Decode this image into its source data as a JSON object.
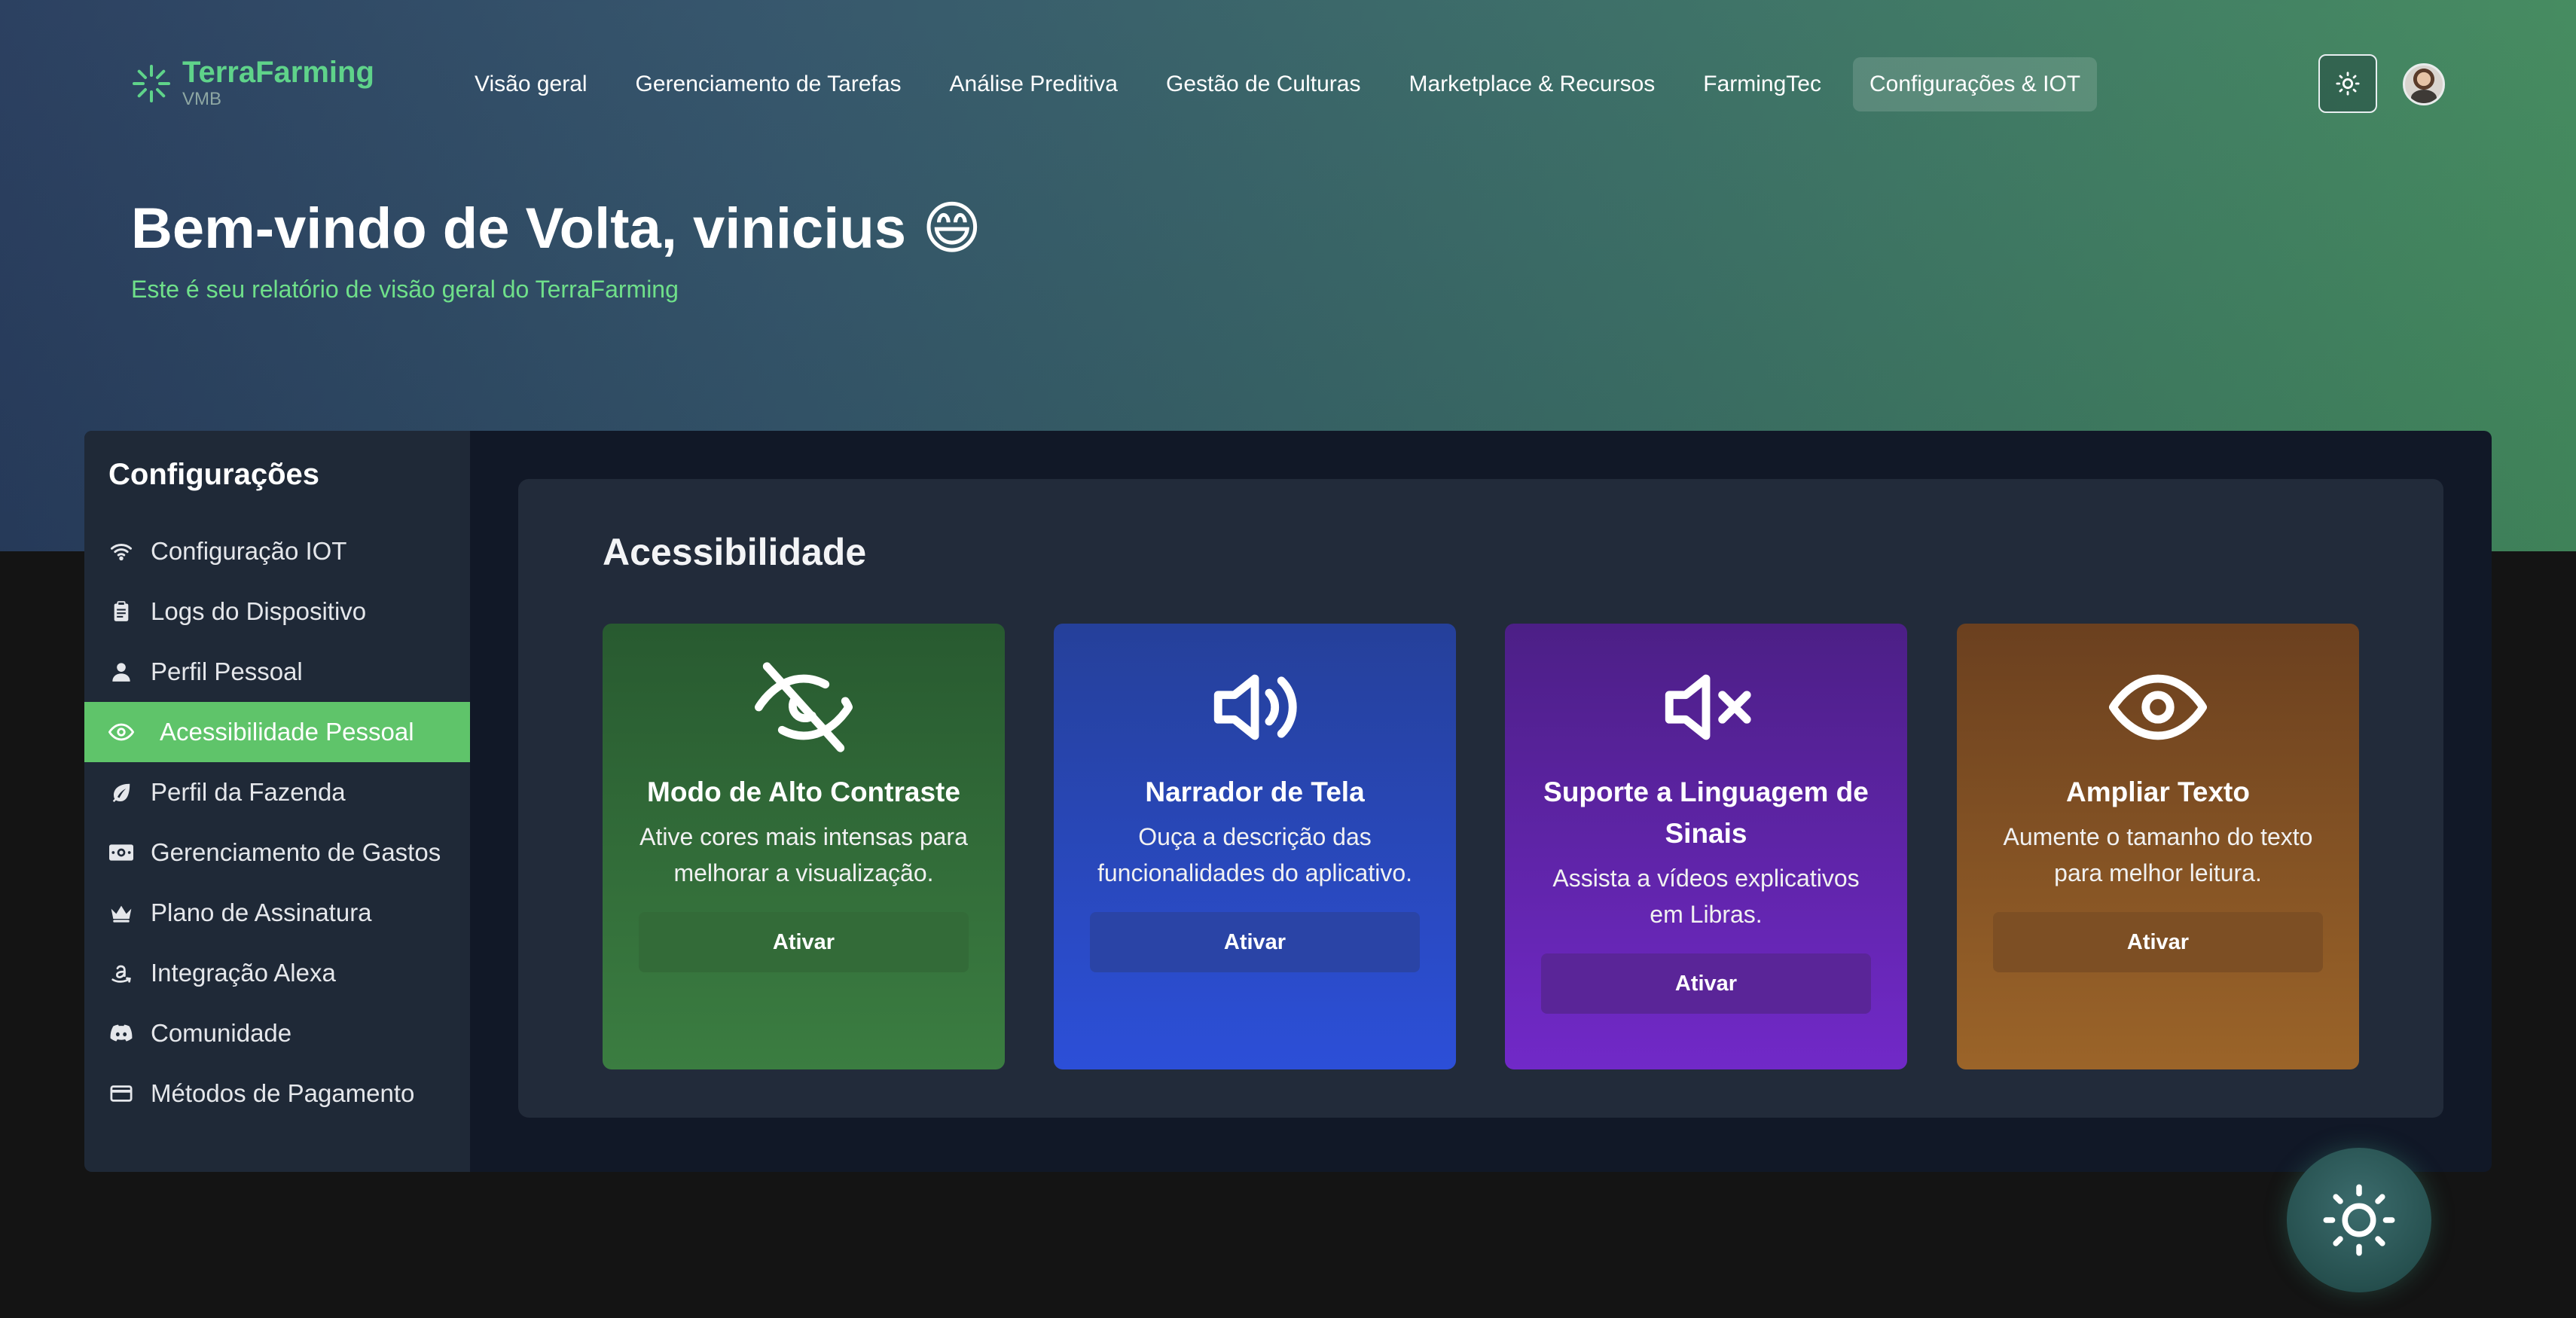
{
  "app": {
    "name": "TerraFarming",
    "sub": "VMB"
  },
  "nav": {
    "items": [
      {
        "label": "Visão geral"
      },
      {
        "label": "Gerenciamento de Tarefas"
      },
      {
        "label": "Análise Preditiva"
      },
      {
        "label": "Gestão de Culturas"
      },
      {
        "label": "Marketplace & Recursos"
      },
      {
        "label": "FarmingTec"
      },
      {
        "label": "Configurações & IOT",
        "active": true
      }
    ]
  },
  "header": {
    "theme_toggle_icon": "sun-icon",
    "avatar": "user-avatar"
  },
  "hero": {
    "welcome": "Bem-vindo de Volta, vinicius 😄",
    "subtitle": "Este é seu relatório de visão geral do TerraFarming"
  },
  "sidebar": {
    "title": "Configurações",
    "items": [
      {
        "label": "Configuração IOT",
        "icon": "wifi-icon"
      },
      {
        "label": "Logs do Dispositivo",
        "icon": "clipboard-icon"
      },
      {
        "label": "Perfil Pessoal",
        "icon": "user-icon"
      },
      {
        "label": "Acessibilidade Pessoal",
        "icon": "eye-icon",
        "active": true
      },
      {
        "label": "Perfil da Fazenda",
        "icon": "leaf-icon"
      },
      {
        "label": "Gerenciamento de Gastos",
        "icon": "money-icon"
      },
      {
        "label": "Plano de Assinatura",
        "icon": "crown-icon"
      },
      {
        "label": "Integração Alexa",
        "icon": "amazon-icon"
      },
      {
        "label": "Comunidade",
        "icon": "discord-icon"
      },
      {
        "label": "Métodos de Pagamento",
        "icon": "credit-card-icon"
      }
    ]
  },
  "main": {
    "title": "Acessibilidade",
    "cards": [
      {
        "title": "Modo de Alto Contraste",
        "desc": "Ative cores mais intensas para melhorar a visualização.",
        "button": "Ativar",
        "icon": "eye-off-icon",
        "color": "#2f6e37"
      },
      {
        "title": "Narrador de Tela",
        "desc": "Ouça a descrição das funcionalidades do aplicativo.",
        "button": "Ativar",
        "icon": "volume-icon",
        "color": "#2947c0"
      },
      {
        "title": "Suporte a Linguagem de Sinais",
        "desc": "Assista a vídeos explicativos em Libras.",
        "button": "Ativar",
        "icon": "volume-mute-icon",
        "color": "#6227b0"
      },
      {
        "title": "Ampliar Texto",
        "desc": "Aumente o tamanho do texto para melhor leitura.",
        "button": "Ativar",
        "icon": "eye-icon",
        "color": "#865425"
      }
    ]
  },
  "fab": {
    "icon": "sun-icon"
  },
  "colors": {
    "accent": "#5fc46a",
    "brand": "#5fd38a",
    "panel": "#111827",
    "sidebar": "#1f2937"
  }
}
